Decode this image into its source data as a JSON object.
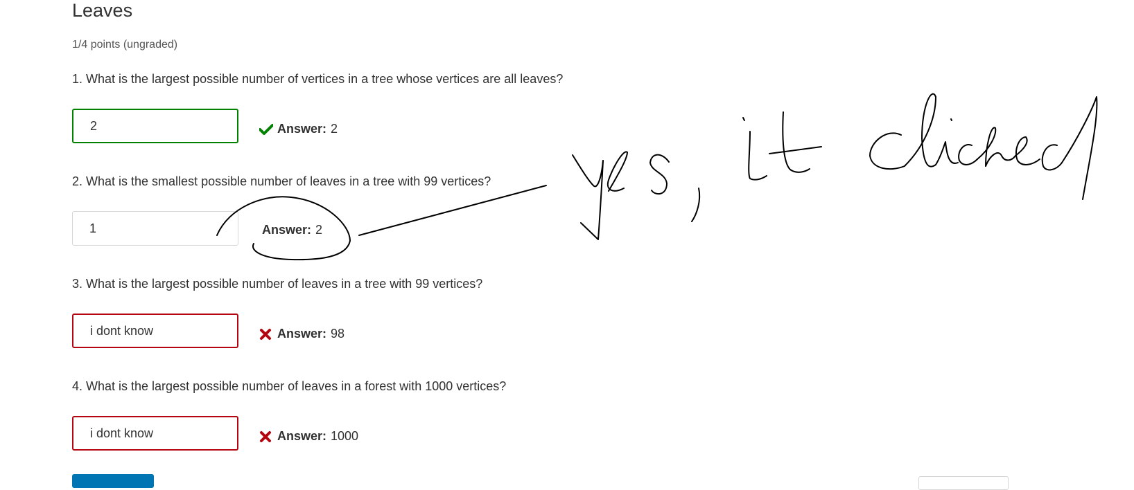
{
  "page": {
    "title": "Leaves",
    "score": "1/4 points (ungraded)"
  },
  "questions": [
    {
      "text": "1. What is the largest possible number of vertices in a tree whose vertices are all leaves?",
      "value": "2",
      "state": "correct",
      "answer_label": "Answer:",
      "answer_value": "2",
      "icon": "check-icon"
    },
    {
      "text": "2. What is the smallest possible number of leaves in a tree with 99 vertices?",
      "value": "1",
      "state": "unmarked",
      "answer_label": "Answer:",
      "answer_value": "2",
      "icon": ""
    },
    {
      "text": "3. What is the largest possible number of leaves in a tree with 99 vertices?",
      "value": "i dont know",
      "state": "incorrect",
      "answer_label": "Answer:",
      "answer_value": "98",
      "icon": "cross-icon"
    },
    {
      "text": "4. What is the largest possible number of leaves in a forest with 1000 vertices?",
      "value": "i dont know",
      "state": "incorrect",
      "answer_label": "Answer:",
      "answer_value": "1000",
      "icon": "cross-icon"
    }
  ],
  "annotation": {
    "handwritten_text": "yes, it clicked"
  },
  "colors": {
    "correct": "#008100",
    "incorrect": "#b20610",
    "primary_button": "#0075b4"
  }
}
